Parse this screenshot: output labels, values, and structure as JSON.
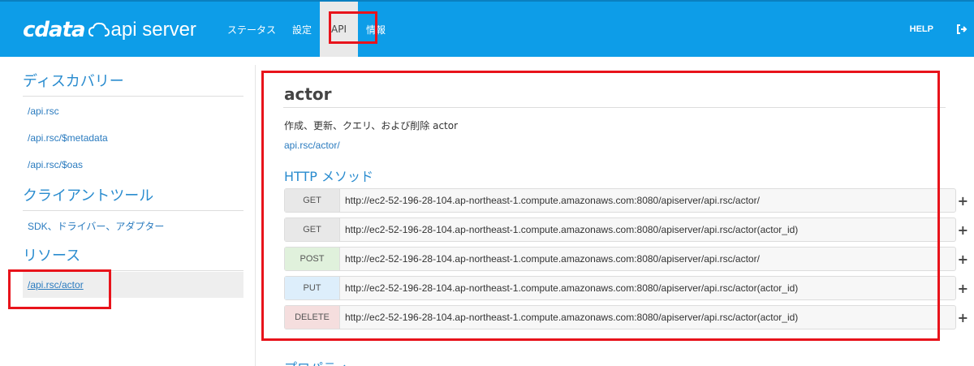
{
  "brand": {
    "logo_text": "cdata",
    "product": "api server"
  },
  "nav": {
    "items": [
      {
        "label": "ステータス"
      },
      {
        "label": "設定"
      },
      {
        "label": "API"
      },
      {
        "label": "情報"
      }
    ],
    "help": "HELP"
  },
  "sidebar": {
    "discovery": {
      "heading": "ディスカバリー",
      "links": [
        {
          "label": "/api.rsc"
        },
        {
          "label": "/api.rsc/$metadata"
        },
        {
          "label": "/api.rsc/$oas"
        }
      ]
    },
    "client_tools": {
      "heading": "クライアントツール",
      "links": [
        {
          "label": "SDK、ドライバー、アダプター"
        }
      ]
    },
    "resources": {
      "heading": "リソース",
      "links": [
        {
          "label": "/api.rsc/actor"
        }
      ]
    }
  },
  "resource": {
    "title": "actor",
    "description": "作成、更新、クエリ、および削除 actor",
    "path": "api.rsc/actor/",
    "http_heading": "HTTP メソッド",
    "methods": [
      {
        "method": "GET",
        "url": "http://ec2-52-196-28-104.ap-northeast-1.compute.amazonaws.com:8080/apiserver/api.rsc/actor/"
      },
      {
        "method": "GET",
        "url": "http://ec2-52-196-28-104.ap-northeast-1.compute.amazonaws.com:8080/apiserver/api.rsc/actor(actor_id)"
      },
      {
        "method": "POST",
        "url": "http://ec2-52-196-28-104.ap-northeast-1.compute.amazonaws.com:8080/apiserver/api.rsc/actor/"
      },
      {
        "method": "PUT",
        "url": "http://ec2-52-196-28-104.ap-northeast-1.compute.amazonaws.com:8080/apiserver/api.rsc/actor(actor_id)"
      },
      {
        "method": "DELETE",
        "url": "http://ec2-52-196-28-104.ap-northeast-1.compute.amazonaws.com:8080/apiserver/api.rsc/actor(actor_id)"
      }
    ],
    "expand_symbol": "+",
    "properties_heading": "プロパティ"
  },
  "colors": {
    "navbar": "#0d9de8",
    "link": "#2a7bbf",
    "highlight": "#e8131b"
  }
}
